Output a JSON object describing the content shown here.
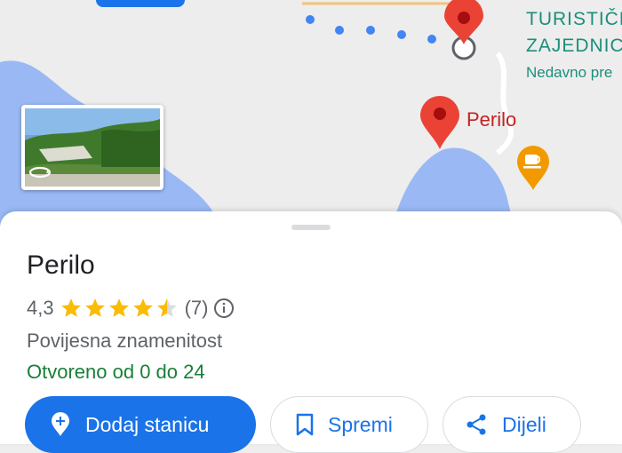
{
  "map": {
    "labels": {
      "turisticka_line1": "TURISTIČK",
      "turisticka_line2": "ZAJEDNIC",
      "turisticka_line3": "Nedavno pre",
      "perilo_pin": "Perilo"
    },
    "icons": {
      "pin": "red-location-pin",
      "cafe": "coffee-cup",
      "street_view": "rotate-360"
    }
  },
  "place": {
    "name": "Perilo",
    "rating": "4,3",
    "stars": 4.3,
    "reviews": "(7)",
    "category": "Povijesna znamenitost",
    "hours": "Otvoreno od 0 do 24"
  },
  "actions": {
    "add_stop": "Dodaj stanicu",
    "save": "Spremi",
    "share": "Dijeli"
  },
  "colors": {
    "accent": "#1a73e8",
    "pin": "#ea4335",
    "open": "#188038",
    "star": "#fbbc04",
    "water": "#9ab9f4"
  }
}
